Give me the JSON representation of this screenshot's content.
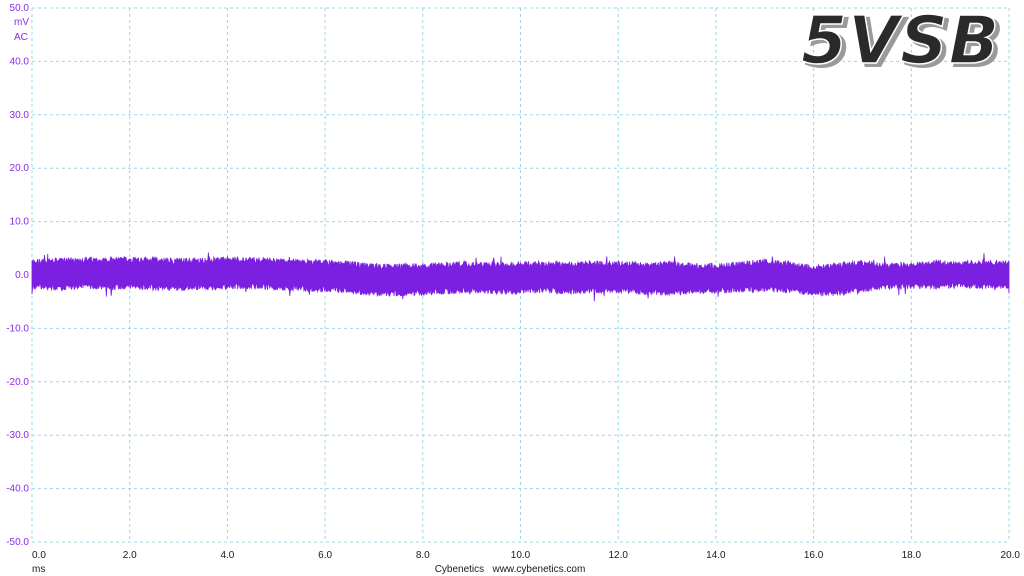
{
  "chart_data": {
    "type": "line",
    "title": "5VSB",
    "ylabel": "mV",
    "ylabel_mode": "AC",
    "xlabel": "ms",
    "footer": "Cybenetics   www.cybenetics.com",
    "xlim": [
      0,
      20
    ],
    "ylim": [
      -50,
      50
    ],
    "x_ticks": [
      "0.0",
      "2.0",
      "4.0",
      "6.0",
      "8.0",
      "10.0",
      "12.0",
      "14.0",
      "16.0",
      "18.0",
      "20.0"
    ],
    "y_ticks": [
      "50.0",
      "40.0",
      "30.0",
      "20.0",
      "10.0",
      "0.0",
      "-10.0",
      "-20.0",
      "-30.0",
      "-40.0",
      "-50.0"
    ],
    "grid": true,
    "series": [
      {
        "x": [
          0,
          0.5,
          1,
          1.5,
          2,
          2.5,
          3,
          3.5,
          4,
          4.5,
          5,
          5.5,
          6,
          6.5,
          7,
          7.5,
          8,
          8.5,
          9,
          9.5,
          10,
          10.5,
          11,
          11.5,
          12,
          12.5,
          13,
          13.5,
          14,
          14.5,
          15,
          15.5,
          16,
          16.5,
          17,
          17.5,
          18,
          18.5,
          19,
          19.5,
          20
        ],
        "upper": [
          2.4,
          2.6,
          2.8,
          2.7,
          2.9,
          2.8,
          2.6,
          2.7,
          2.9,
          2.8,
          2.6,
          2.4,
          2.3,
          2.0,
          1.6,
          1.5,
          1.7,
          1.9,
          2.0,
          1.8,
          2.0,
          2.1,
          1.9,
          2.2,
          2.1,
          1.9,
          2.0,
          1.7,
          1.6,
          2.0,
          2.4,
          2.0,
          1.2,
          1.8,
          2.2,
          1.6,
          1.9,
          2.3,
          2.0,
          2.3,
          2.2
        ],
        "lower": [
          -2.2,
          -2.4,
          -2.0,
          -2.2,
          -2.1,
          -2.3,
          -2.4,
          -2.2,
          -2.1,
          -2.0,
          -2.3,
          -2.5,
          -2.6,
          -2.8,
          -3.3,
          -3.4,
          -3.2,
          -3.0,
          -2.8,
          -3.0,
          -2.9,
          -2.8,
          -3.0,
          -2.8,
          -2.9,
          -3.1,
          -3.3,
          -3.0,
          -2.9,
          -2.7,
          -2.6,
          -2.8,
          -3.3,
          -3.4,
          -2.6,
          -2.1,
          -2.0,
          -2.1,
          -1.9,
          -2.0,
          -2.1
        ],
        "color": "#7b1fe0"
      }
    ]
  },
  "colors": {
    "grid": "#9fd6e2",
    "axis_text_y": "#8a2be2",
    "axis_text_x": "#1a1a1a",
    "trace": "#7b1fe0",
    "title_fill": "#2a2a2a",
    "title_shadow": "#9a9a9a"
  }
}
